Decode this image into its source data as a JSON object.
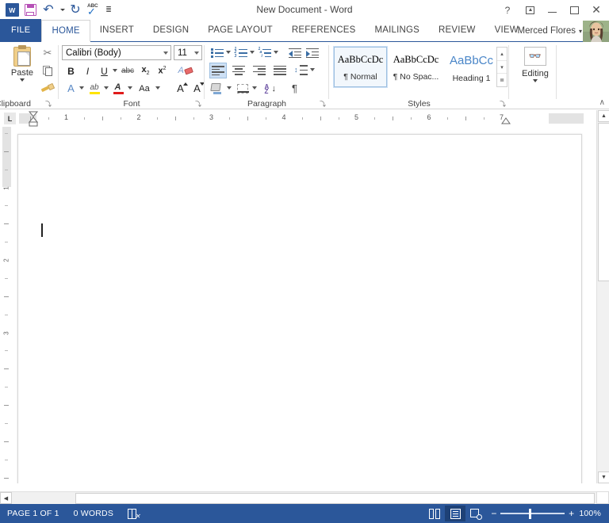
{
  "window": {
    "title": "New Document - Word",
    "app_icon": "word-logo",
    "help_label": "?",
    "ribbon_display_label": "Ribbon Display Options",
    "minimize_label": "Minimize",
    "maximize_label": "Restore Down",
    "close_label": "Close"
  },
  "quick_access": [
    {
      "name": "save",
      "label": "Save"
    },
    {
      "name": "undo",
      "label": "Undo"
    },
    {
      "name": "redo",
      "label": "Repeat"
    },
    {
      "name": "spelling",
      "label": "Spelling & Grammar"
    },
    {
      "name": "customize",
      "label": "Customize Quick Access Toolbar"
    }
  ],
  "tabs": {
    "file": "FILE",
    "items": [
      {
        "label": "HOME",
        "active": true
      },
      {
        "label": "INSERT",
        "active": false
      },
      {
        "label": "DESIGN",
        "active": false
      },
      {
        "label": "PAGE LAYOUT",
        "active": false
      },
      {
        "label": "REFERENCES",
        "active": false
      },
      {
        "label": "MAILINGS",
        "active": false
      },
      {
        "label": "REVIEW",
        "active": false
      },
      {
        "label": "VIEW",
        "active": false
      }
    ]
  },
  "account": {
    "name": "Merced Flores",
    "dropdown": "▾"
  },
  "ribbon": {
    "groups": [
      {
        "key": "clipboard",
        "label": "Clipboard"
      },
      {
        "key": "font",
        "label": "Font"
      },
      {
        "key": "paragraph",
        "label": "Paragraph"
      },
      {
        "key": "styles",
        "label": "Styles"
      },
      {
        "key": "editing",
        "label": "Editing"
      }
    ],
    "clipboard": {
      "paste_label": "Paste",
      "cut_label": "Cut",
      "copy_label": "Copy",
      "format_painter_label": "Format Painter"
    },
    "font": {
      "font_name": "Calibri (Body)",
      "font_size": "11",
      "bold": "B",
      "italic": "I",
      "underline": "U",
      "strikethrough": "abc",
      "subscript_base": "x",
      "subscript_index": "2",
      "superscript_base": "x",
      "superscript_index": "2",
      "clear_formatting_label": "Clear All Formatting",
      "text_effects": "A",
      "highlight": "ab",
      "font_color": "A",
      "change_case": "Aa",
      "grow_font": "A",
      "shrink_font": "A"
    },
    "paragraph": {
      "bullets_label": "Bullets",
      "numbering_label": "Numbering",
      "multilevel_label": "Multilevel List",
      "decrease_indent_label": "Decrease Indent",
      "increase_indent_label": "Increase Indent",
      "align_left_label": "Align Left",
      "align_center_label": "Center",
      "align_right_label": "Align Right",
      "justify_label": "Justify",
      "line_spacing_label": "Line and Paragraph Spacing",
      "shading_label": "Shading",
      "borders_label": "Borders",
      "sort_label": "Sort",
      "show_marks": "¶"
    },
    "styles": {
      "items": [
        {
          "preview": "AaBbCcDc",
          "name": "¶ Normal",
          "selected": true,
          "heading": false
        },
        {
          "preview": "AaBbCcDc",
          "name": "¶ No Spac...",
          "selected": false,
          "heading": false
        },
        {
          "preview": "AaBbCc",
          "name": "Heading 1",
          "selected": false,
          "heading": true
        }
      ],
      "scroll_up": "▴",
      "scroll_down": "▾",
      "more": "≣"
    },
    "editing": {
      "label": "Editing",
      "caret": "▾"
    },
    "dialog_launcher_glyph": "⤵",
    "collapse_glyph": "∧"
  },
  "ruler": {
    "tab_stop_selector": "L",
    "numbers": [
      "1",
      "2",
      "3",
      "4",
      "5",
      "6",
      "7"
    ],
    "vertical_numbers": [
      "1",
      "2",
      "3"
    ],
    "unit": "inches"
  },
  "document": {
    "content": "",
    "caret_visible": true
  },
  "status_bar": {
    "page_info": "PAGE 1 OF 1",
    "word_count": "0 WORDS",
    "proofing_label": "Proofing Errors",
    "views": [
      {
        "name": "read-mode",
        "label": "Read Mode",
        "active": false
      },
      {
        "name": "print-layout",
        "label": "Print Layout",
        "active": true
      },
      {
        "name": "web-layout",
        "label": "Web Layout",
        "active": false
      }
    ],
    "zoom_out": "−",
    "zoom_in": "+",
    "zoom_level": "100%"
  },
  "colors": {
    "brand_blue": "#2b579a",
    "status_bar": "#2b579a",
    "accent_selection": "#cde0f5",
    "heading_blue": "#4a86c8",
    "highlight_yellow": "#ffe400",
    "font_color_red": "#e01b1b",
    "save_purple": "#b64fb6"
  }
}
